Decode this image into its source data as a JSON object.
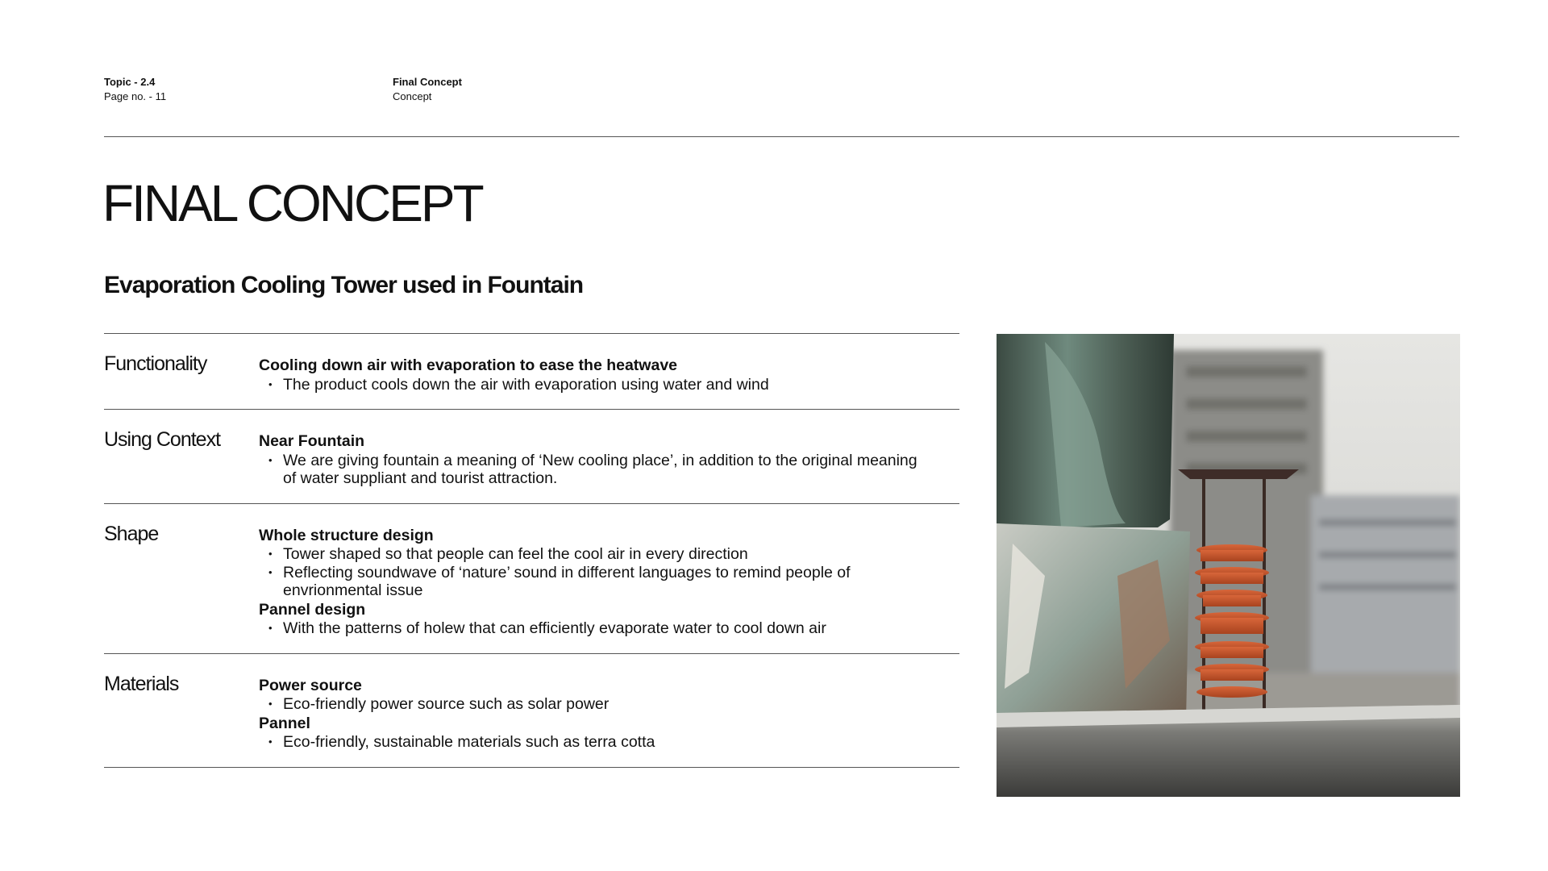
{
  "header": {
    "topic": "Topic - 2.4",
    "page": "Page no. - 11",
    "section_title": "Final Concept",
    "section_sub": "Concept"
  },
  "title": "FINAL CONCEPT",
  "subtitle": "Evaporation Cooling Tower used in Fountain",
  "rows": [
    {
      "label": "Functionality",
      "groups": [
        {
          "heading": "Cooling down air with evaporation to ease the heatwave",
          "bullets": [
            "The product cools down the air with evaporation using water and wind"
          ]
        }
      ]
    },
    {
      "label": "Using Context",
      "groups": [
        {
          "heading": "Near Fountain",
          "bullets": [
            "We are giving fountain a meaning of ‘New cooling place’, in addition to the original meaning of water suppliant and tourist attraction."
          ]
        }
      ]
    },
    {
      "label": "Shape",
      "groups": [
        {
          "heading": "Whole structure design",
          "bullets": [
            "Tower shaped so that people can feel the cool air in every direction",
            "Reflecting soundwave of ‘nature’ sound in different languages to remind people of envrionmental issue"
          ]
        },
        {
          "heading": "Pannel design",
          "bullets": [
            "With the patterns of holew that can efficiently evaporate water to cool down air"
          ]
        }
      ]
    },
    {
      "label": "Materials",
      "groups": [
        {
          "heading": "Power source",
          "bullets": [
            "Eco-friendly power source such as solar power"
          ]
        },
        {
          "heading": "Pannel",
          "bullets": [
            "Eco-friendly, sustainable materials such as terra cotta"
          ]
        }
      ]
    }
  ]
}
